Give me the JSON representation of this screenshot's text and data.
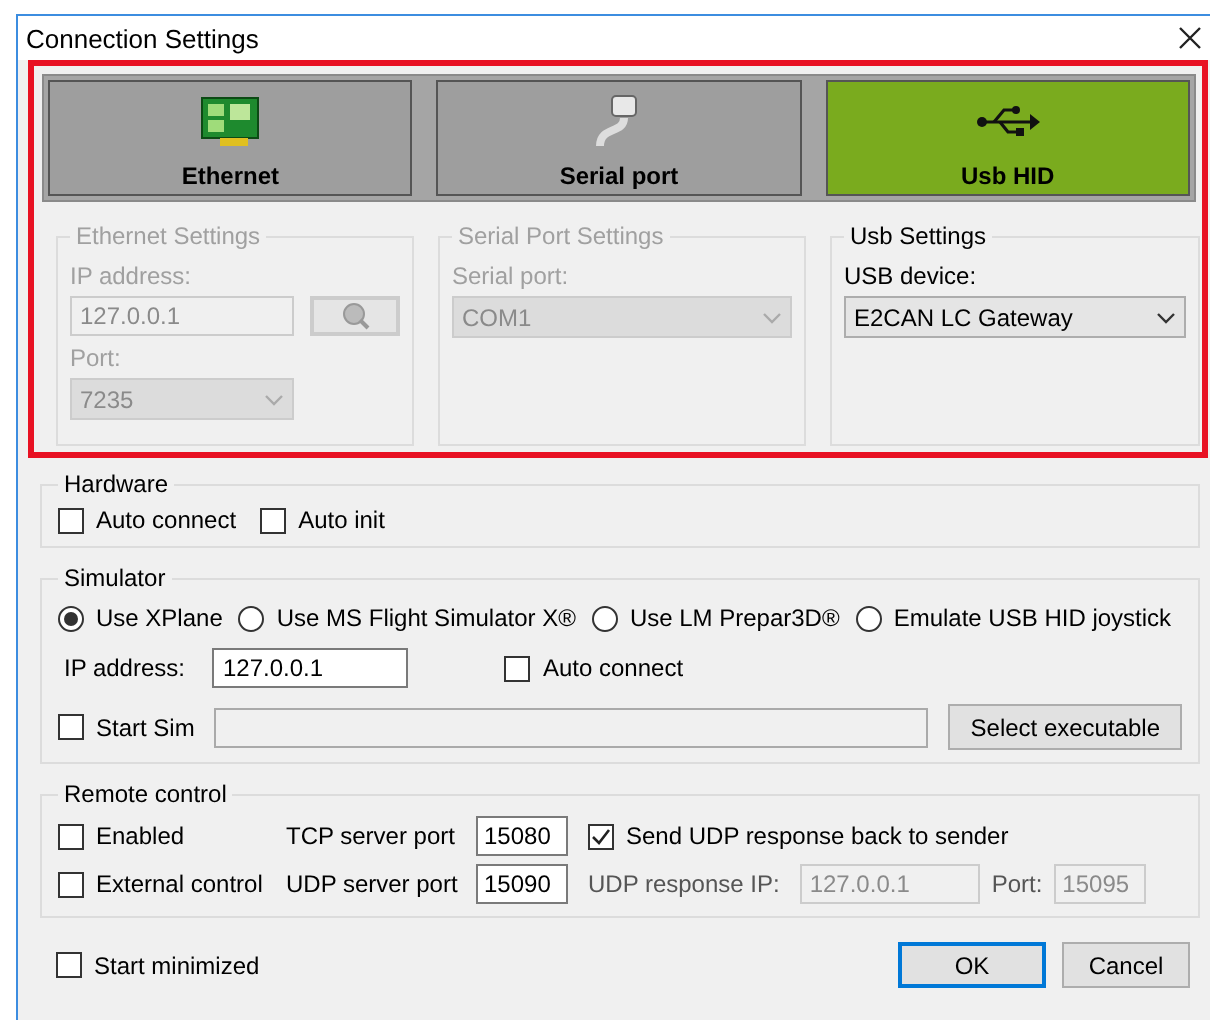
{
  "window": {
    "title": "Connection Settings"
  },
  "connection_tabs": [
    {
      "label": "Ethernet",
      "kind": "ethernet",
      "selected": false
    },
    {
      "label": "Serial port",
      "kind": "serial",
      "selected": false
    },
    {
      "label": "Usb HID",
      "kind": "usb",
      "selected": true
    }
  ],
  "ethernet_settings": {
    "title": "Ethernet Settings",
    "disabled": true,
    "ip_label": "IP address:",
    "ip_value": "127.0.0.1",
    "port_label": "Port:",
    "port_value": "7235"
  },
  "serial_settings": {
    "title": "Serial Port Settings",
    "disabled": true,
    "port_label": "Serial port:",
    "port_value": "COM1"
  },
  "usb_settings": {
    "title": "Usb Settings",
    "disabled": false,
    "device_label": "USB device:",
    "device_value": "E2CAN LC Gateway"
  },
  "hardware": {
    "title": "Hardware",
    "options": [
      {
        "label": "Auto connect",
        "checked": false
      },
      {
        "label": "Auto init",
        "checked": false
      }
    ]
  },
  "simulator": {
    "title": "Simulator",
    "modes": [
      {
        "label": "Use XPlane",
        "selected": true
      },
      {
        "label": "Use MS Flight Simulator X®",
        "selected": false
      },
      {
        "label": "Use LM Prepar3D®",
        "selected": false
      },
      {
        "label": "Emulate USB HID joystick",
        "selected": false
      }
    ],
    "ip_label": "IP address:",
    "ip_value": "127.0.0.1",
    "auto_connect": {
      "label": "Auto connect",
      "checked": false
    },
    "start_sim": {
      "label": "Start Sim",
      "checked": false
    },
    "select_button": "Select executable"
  },
  "remote_control": {
    "title": "Remote control",
    "enabled": {
      "label": "Enabled",
      "checked": false
    },
    "external": {
      "label": "External control",
      "checked": false
    },
    "tcp_label": "TCP server port",
    "tcp_value": "15080",
    "udp_label": "UDP server port",
    "udp_value": "15090",
    "send_udp": {
      "label": "Send UDP response back to sender",
      "checked": true
    },
    "response_ip_label": "UDP response IP:",
    "response_ip_value": "127.0.0.1",
    "response_disabled": true,
    "port_label": "Port:",
    "port_value": "15095"
  },
  "start_minimized": {
    "label": "Start minimized",
    "checked": false
  },
  "buttons": [
    {
      "label": "OK",
      "kind": "default"
    },
    {
      "label": "Cancel",
      "kind": "normal"
    }
  ]
}
